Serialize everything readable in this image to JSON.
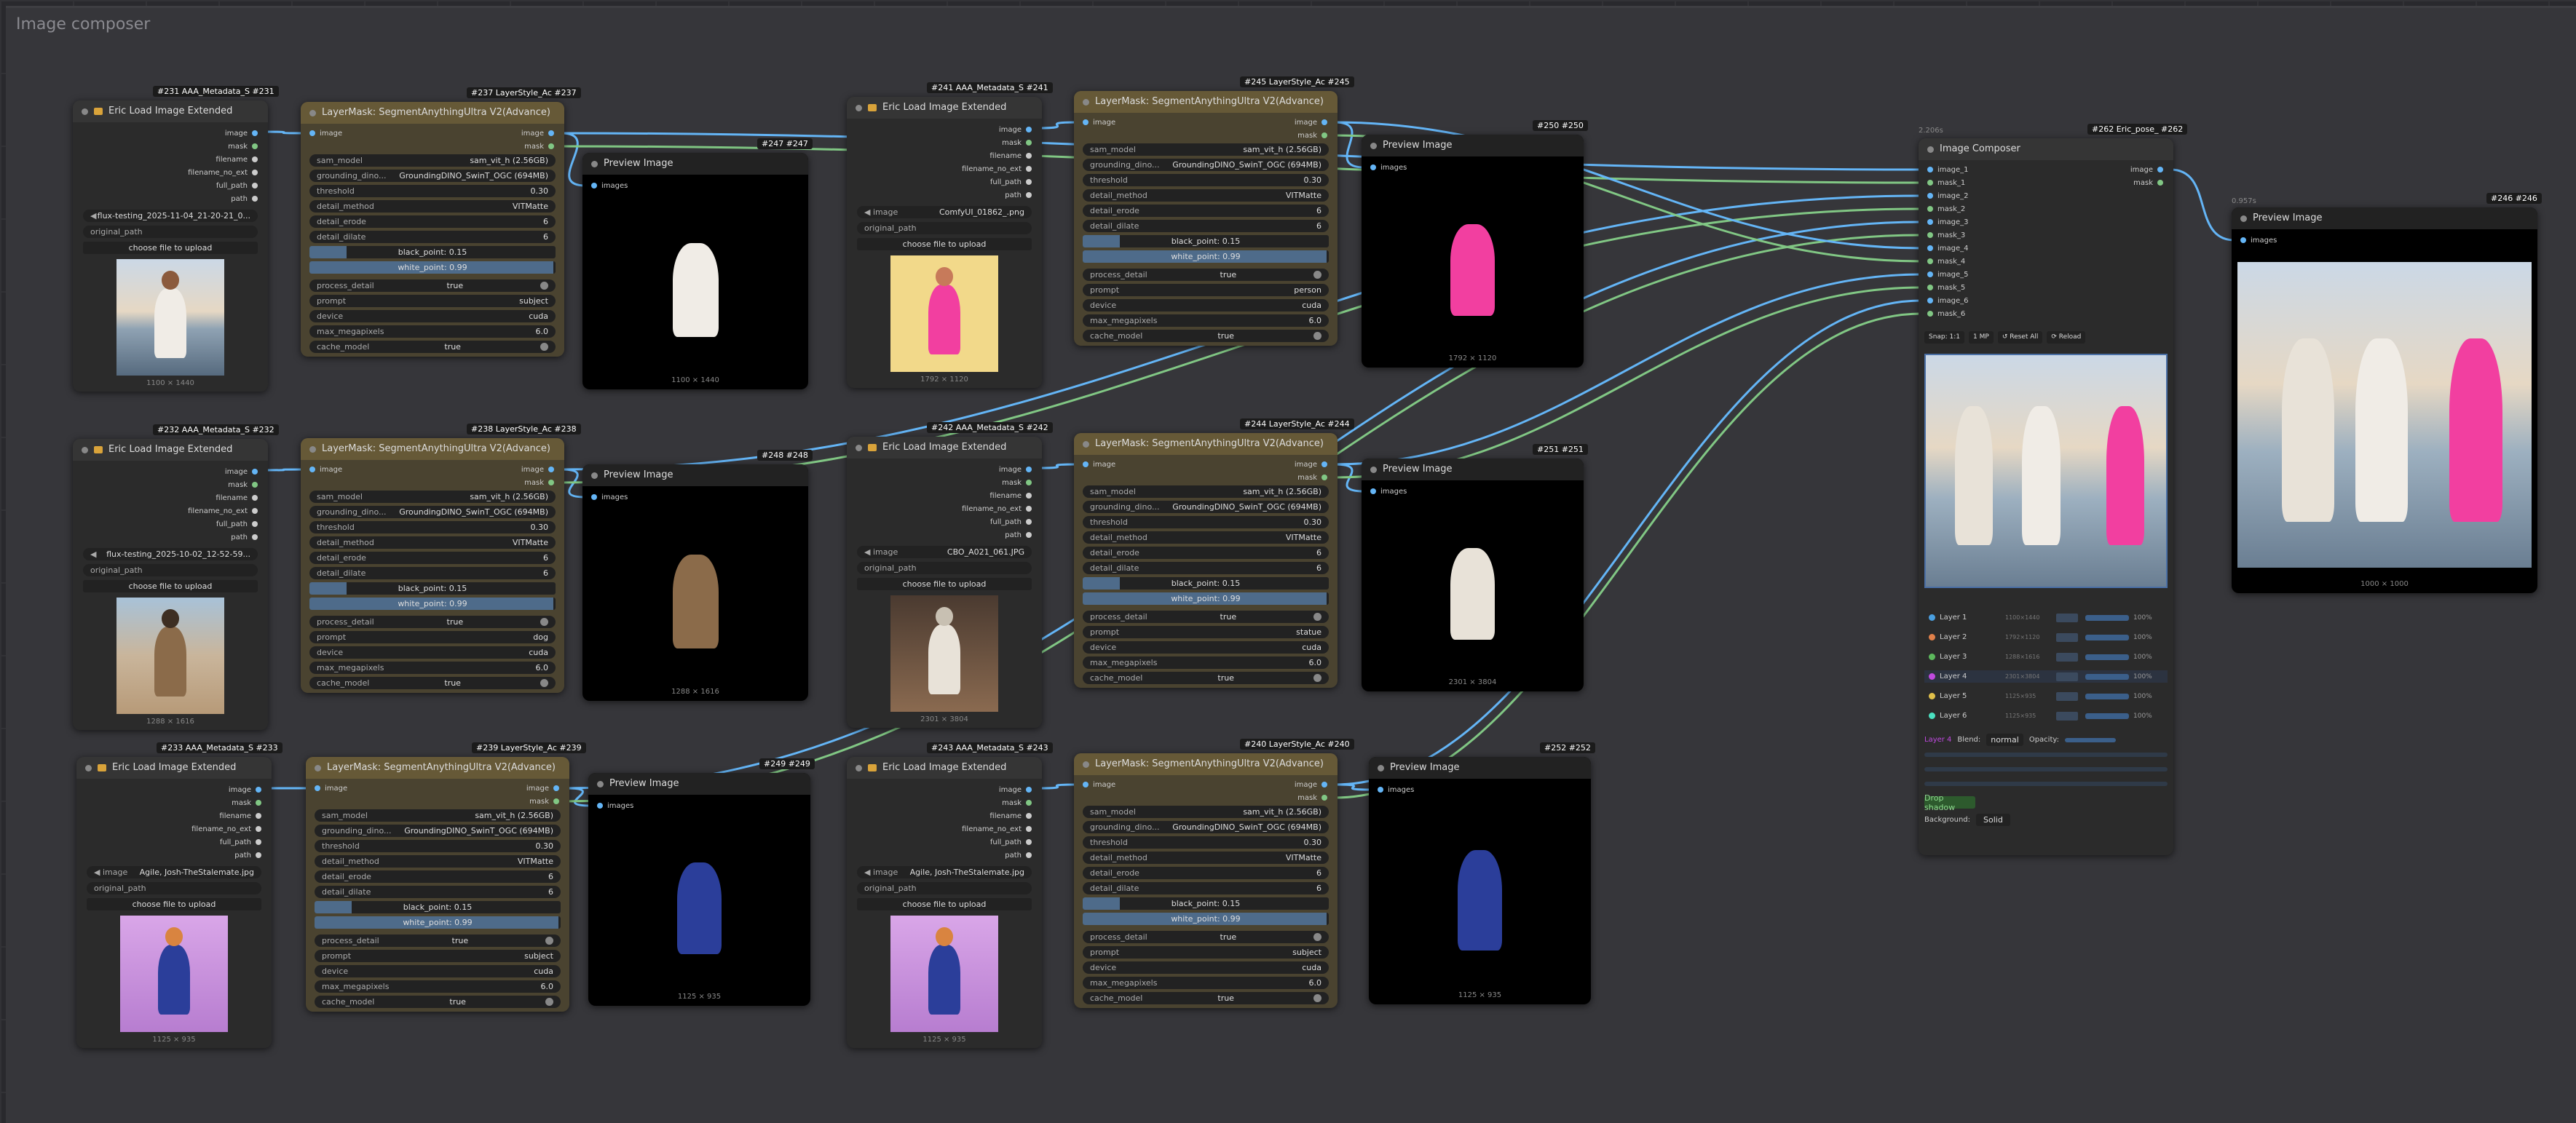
{
  "app": {
    "group_title": "Image composer"
  },
  "colors": {
    "canvas": "#29292d",
    "group": "#36363a",
    "node": "#2b2b2b",
    "brown": "#4a4330",
    "image_link": "#64b5f6",
    "mask_link": "#81c784"
  },
  "loaders": [
    {
      "badge": "#231 AAA_Metadata_S  #231",
      "title": "Eric Load Image Extended",
      "file": "flux-testing_2025-11-04_21-20-21_0...",
      "original_path": "original_path",
      "upload": "choose file to upload",
      "dims": "1100 × 1440",
      "outputs": [
        "image",
        "mask",
        "filename",
        "filename_no_ext",
        "full_path",
        "path"
      ],
      "file_prefix": "◀"
    },
    {
      "badge": "#232 AAA_Metadata_S  #232",
      "title": "Eric Load Image Extended",
      "file": "flux-testing_2025-10-02_12-52-59...",
      "original_path": "original_path",
      "upload": "choose file to upload",
      "dims": "1288 × 1616",
      "outputs": [
        "image",
        "mask",
        "filename",
        "filename_no_ext",
        "full_path",
        "path"
      ],
      "file_prefix": "◀"
    },
    {
      "badge": "#233 AAA_Metadata_S  #233",
      "title": "Eric Load Image Extended",
      "file": "Agile, Josh-TheStalemate.jpg",
      "original_path": "original_path",
      "upload": "choose file to upload",
      "dims": "1125 × 935",
      "outputs": [
        "image",
        "mask",
        "filename",
        "filename_no_ext",
        "full_path",
        "path"
      ],
      "file_prefix": "◀ image"
    },
    {
      "badge": "#241 AAA_Metadata_S  #241",
      "title": "Eric Load Image Extended",
      "file": "ComfyUI_01862_.png",
      "original_path": "original_path",
      "upload": "choose file to upload",
      "dims": "1792 × 1120",
      "outputs": [
        "image",
        "mask",
        "filename",
        "filename_no_ext",
        "full_path",
        "path"
      ],
      "file_prefix": "◀ image"
    },
    {
      "badge": "#242 AAA_Metadata_S  #242",
      "title": "Eric Load Image Extended",
      "file": "CBO_A021_061.JPG",
      "original_path": "original_path",
      "upload": "choose file to upload",
      "dims": "2301 × 3804",
      "outputs": [
        "image",
        "mask",
        "filename",
        "filename_no_ext",
        "full_path",
        "path"
      ],
      "file_prefix": "◀ image"
    },
    {
      "badge": "#243 AAA_Metadata_S  #243",
      "title": "Eric Load Image Extended",
      "file": "Agile, Josh-TheStalemate.jpg",
      "original_path": "original_path",
      "upload": "choose file to upload",
      "dims": "1125 × 935",
      "outputs": [
        "image",
        "mask",
        "filename",
        "filename_no_ext",
        "full_path",
        "path"
      ],
      "file_prefix": "◀ image"
    }
  ],
  "segmenters": [
    {
      "badge": "#237 LayerStyle_Ac  #237",
      "title": "LayerMask: SegmentAnythingUltra V2(Advance)",
      "prompt": "subject"
    },
    {
      "badge": "#238 LayerStyle_Ac  #238",
      "title": "LayerMask: SegmentAnythingUltra V2(Advance)",
      "prompt": "dog"
    },
    {
      "badge": "#239 LayerStyle_Ac  #239",
      "title": "LayerMask: SegmentAnythingUltra V2(Advance)",
      "prompt": "subject"
    },
    {
      "badge": "#245 LayerStyle_Ac  #245",
      "title": "LayerMask: SegmentAnythingUltra V2(Advance)",
      "prompt": "person"
    },
    {
      "badge": "#244 LayerStyle_Ac  #244",
      "title": "LayerMask: SegmentAnythingUltra V2(Advance)",
      "prompt": "statue"
    },
    {
      "badge": "#240 LayerStyle_Ac  #240",
      "title": "LayerMask: SegmentAnythingUltra V2(Advance)",
      "prompt": "subject"
    }
  ],
  "seg_common": {
    "input_image": "image",
    "out_image": "image",
    "out_mask": "mask",
    "sam_model_l": "sam_model",
    "sam_model_v": "sam_vit_h (2.56GB)",
    "grounding_l": "grounding_dino...",
    "grounding_v": "GroundingDINO_SwinT_OGC (694MB)",
    "threshold_l": "threshold",
    "threshold_v": "0.30",
    "detail_method_l": "detail_method",
    "detail_method_v": "VITMatte",
    "detail_erode_l": "detail_erode",
    "detail_erode_v": "6",
    "detail_dilate_l": "detail_dilate",
    "detail_dilate_v": "6",
    "black_point": "black_point: 0.15",
    "white_point": "white_point: 0.99",
    "process_detail_l": "process_detail",
    "process_detail_v": "true",
    "prompt_l": "prompt",
    "device_l": "device",
    "device_v": "cuda",
    "max_mp_l": "max_megapixels",
    "max_mp_v": "6.0",
    "cache_l": "cache_model",
    "cache_v": "true"
  },
  "previews": [
    {
      "badge": "#247  #247",
      "title": "Preview Image",
      "input": "images",
      "dims": "1100 × 1440"
    },
    {
      "badge": "#248  #248",
      "title": "Preview Image",
      "input": "images",
      "dims": "1288 × 1616"
    },
    {
      "badge": "#249  #249",
      "title": "Preview Image",
      "input": "images",
      "dims": "1125 × 935"
    },
    {
      "badge": "#250  #250",
      "title": "Preview Image",
      "input": "images",
      "dims": "1792 × 1120"
    },
    {
      "badge": "#251  #251",
      "title": "Preview Image",
      "input": "images",
      "dims": "2301 × 3804"
    },
    {
      "badge": "#252  #252",
      "title": "Preview Image",
      "input": "images",
      "dims": "1125 × 935"
    },
    {
      "badge": "#246  #246",
      "title": "Preview Image",
      "input": "images",
      "dims": "1000 × 1000",
      "timing": "0.957s"
    }
  ],
  "composer": {
    "badge": "#262 Eric_pose_  #262",
    "timing": "2.206s",
    "title": "Image Composer",
    "inputs": [
      "image_1",
      "mask_1",
      "image_2",
      "mask_2",
      "image_3",
      "mask_3",
      "image_4",
      "mask_4",
      "image_5",
      "mask_5",
      "image_6",
      "mask_6"
    ],
    "outputs": [
      "image",
      "mask"
    ],
    "toolbar": {
      "snap": "Snap: 1:1",
      "res": "1 MP",
      "reset": "↺ Reset All",
      "reload": "⟳ Reload"
    },
    "layers": [
      {
        "name": "Layer 1",
        "meta": "1100×1440",
        "pct": "100%",
        "color": "#4a9fe0"
      },
      {
        "name": "Layer 2",
        "meta": "1792×1120",
        "pct": "100%",
        "color": "#e0804a"
      },
      {
        "name": "Layer 3",
        "meta": "1288×1616",
        "pct": "100%",
        "color": "#5cb85c"
      },
      {
        "name": "Layer 4",
        "meta": "2301×3804",
        "pct": "100%",
        "color": "#c04ae0"
      },
      {
        "name": "Layer 5",
        "meta": "1125×935",
        "pct": "100%",
        "color": "#e0c04a"
      },
      {
        "name": "Layer 6",
        "meta": "1125×935",
        "pct": "100%",
        "color": "#4ae0c0"
      }
    ],
    "sel_label": "Layer 4",
    "blend_l": "Blend:",
    "blend_v": "normal",
    "opacity_l": "Opacity:",
    "shadow_btn": "Drop shadow",
    "bg_l": "Background:",
    "bg_v": "Solid"
  }
}
